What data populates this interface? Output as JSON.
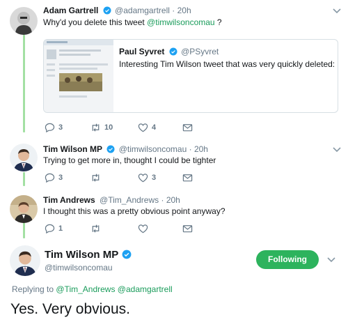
{
  "colors": {
    "accent": "#2db35d",
    "mention": "#1a9c5b",
    "thread_line": "#a3e0a3",
    "muted": "#657786"
  },
  "tweets": [
    {
      "name": "Adam Gartrell",
      "verified": true,
      "handle": "@adamgartrell",
      "dot": "·",
      "time": "20h",
      "text_prefix": "Why'd you delete this tweet ",
      "mention": "@timwilsoncomau",
      "text_suffix": " ?",
      "quote": {
        "name": "Paul Syvret",
        "verified": true,
        "handle": "@PSyvret",
        "text": "Interesting Tim Wilson tweet that was very quickly deleted:"
      },
      "counts": {
        "replies": "3",
        "retweets": "10",
        "likes": "4"
      }
    },
    {
      "name": "Tim Wilson MP",
      "verified": true,
      "handle": "@timwilsoncomau",
      "dot": "·",
      "time": "20h",
      "text": "Trying to get more in, thought I could be tighter",
      "counts": {
        "replies": "3",
        "retweets": "",
        "likes": "3"
      }
    },
    {
      "name": "Tim Andrews",
      "handle": "@Tim_Andrews",
      "dot": "·",
      "time": "20h",
      "text": "I thought this was a pretty obvious point anyway?",
      "counts": {
        "replies": "1",
        "retweets": "",
        "likes": ""
      }
    }
  ],
  "main_tweet": {
    "name": "Tim Wilson MP",
    "verified": true,
    "handle": "@timwilsoncomau",
    "follow_label": "Following",
    "replying_prefix": "Replying to ",
    "replying_mentions": "@Tim_Andrews @adamgartrell",
    "text": "Yes. Very obvious."
  }
}
